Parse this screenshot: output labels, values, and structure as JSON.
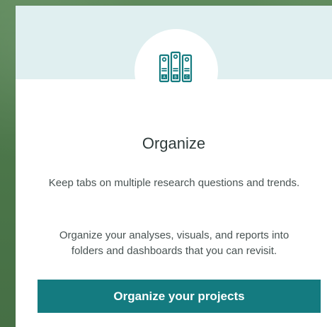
{
  "card": {
    "title": "Organize",
    "paragraph_1": "Keep tabs on multiple research questions and trends.",
    "paragraph_2": "Organize your analyses, visuals, and reports into folders and dashboards that you can revisit.",
    "button_label": "Organize your projects"
  },
  "icon": {
    "name": "binders-icon",
    "labels": [
      "A",
      "B",
      "C"
    ]
  },
  "colors": {
    "background": "#4e7a4c",
    "card_top": "#e0eff0",
    "accent": "#147b80",
    "text": "#2f3b3b",
    "body_text": "#495353"
  }
}
